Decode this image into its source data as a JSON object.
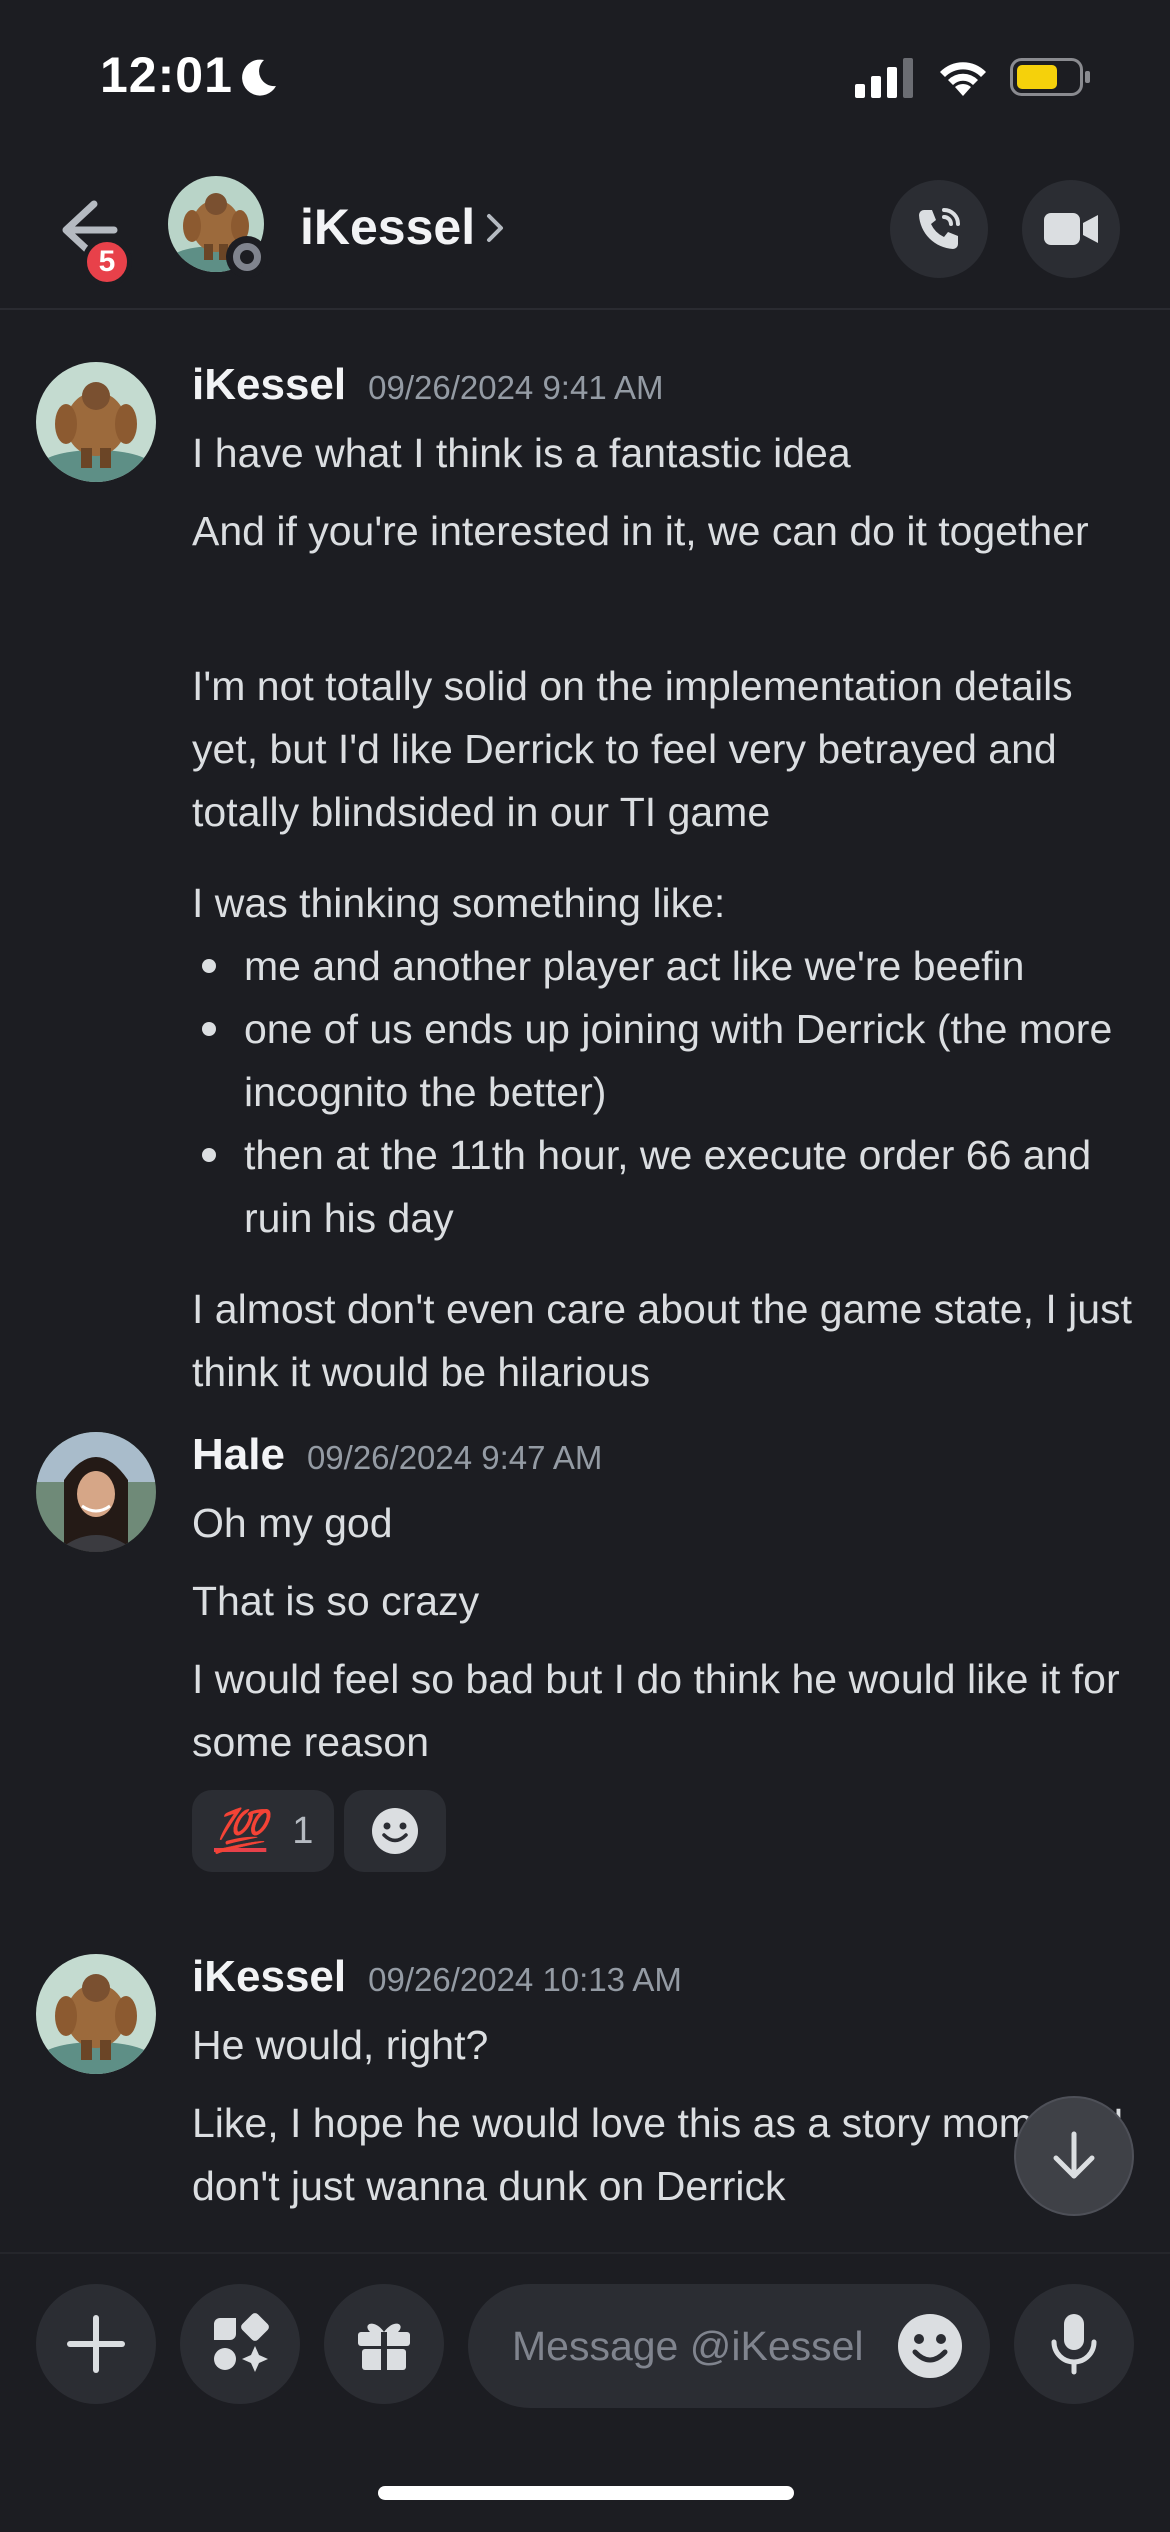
{
  "status_bar": {
    "time": "12:01",
    "icons": [
      "moon-icon",
      "signal-icon",
      "wifi-icon",
      "battery-icon"
    ]
  },
  "header": {
    "unread_count": "5",
    "channel_name": "iKessel",
    "icons": [
      "back-arrow-icon",
      "chevron-right-icon",
      "phone-call-icon",
      "video-camera-icon"
    ]
  },
  "messages": [
    {
      "author": "iKessel",
      "timestamp": "09/26/2024 9:41 AM",
      "lines": [
        "I have what I think is a fantastic idea",
        "And if you're interested in it, we can do it together",
        "I'm not totally solid on the implementation details yet, but I'd like Derrick to feel very betrayed and totally blindsided in our TI game",
        "I was thinking something like:"
      ],
      "bullets": [
        "me and another player act like we're beefin",
        "one of us ends up joining with Derrick (the more incognito the better)",
        "then at the 11th hour, we execute order 66 and ruin his day"
      ],
      "closing": "I almost don't even care about the game state, I just think it would be hilarious"
    },
    {
      "author": "Hale",
      "timestamp": "09/26/2024 9:47 AM",
      "lines": [
        "Oh my god",
        "That is so crazy",
        "I would feel so bad but I do think he would like it for some reason"
      ],
      "reactions": [
        {
          "emoji": "💯",
          "count": "1"
        }
      ]
    },
    {
      "author": "iKessel",
      "timestamp": "09/26/2024 10:13 AM",
      "lines": [
        "He would, right?",
        "Like, I hope he would love this as a story moment. I don't just wanna dunk on Derrick"
      ]
    }
  ],
  "composer": {
    "placeholder": "Message @iKessel",
    "icons": [
      "plus-icon",
      "apps-icon",
      "gift-icon",
      "emoji-icon",
      "microphone-icon"
    ]
  },
  "colors": {
    "background": "#1c1d22",
    "surface": "#2b2d33",
    "text": "#dbdee1",
    "muted": "#949ba4",
    "badge": "#e8414a",
    "battery": "#f5d10b"
  }
}
